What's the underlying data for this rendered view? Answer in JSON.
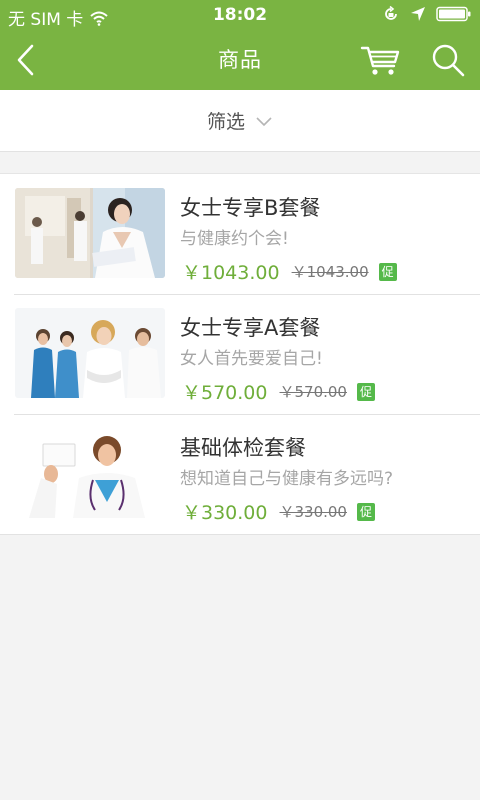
{
  "status_bar": {
    "carrier": "无 SIM 卡",
    "time": "18:02"
  },
  "header": {
    "title": "商品",
    "back_icon": "back-arrow-icon",
    "cart_icon": "cart-icon",
    "search_icon": "search-icon"
  },
  "filter": {
    "label": "筛选"
  },
  "products": [
    {
      "title": "女士专享B套餐",
      "subtitle": "与健康约个会!",
      "price": "￥1043.00",
      "old_price": "￥1043.00",
      "promo": "促"
    },
    {
      "title": "女士专享A套餐",
      "subtitle": "女人首先要爱自己!",
      "price": "￥570.00",
      "old_price": "￥570.00",
      "promo": "促"
    },
    {
      "title": "基础体检套餐",
      "subtitle": "想知道自己与健康有多远吗?",
      "price": "￥330.00",
      "old_price": "￥330.00",
      "promo": "促"
    }
  ],
  "colors": {
    "brand_green": "#7ab442",
    "price_green": "#6fae3a",
    "promo_green": "#55b94a"
  }
}
